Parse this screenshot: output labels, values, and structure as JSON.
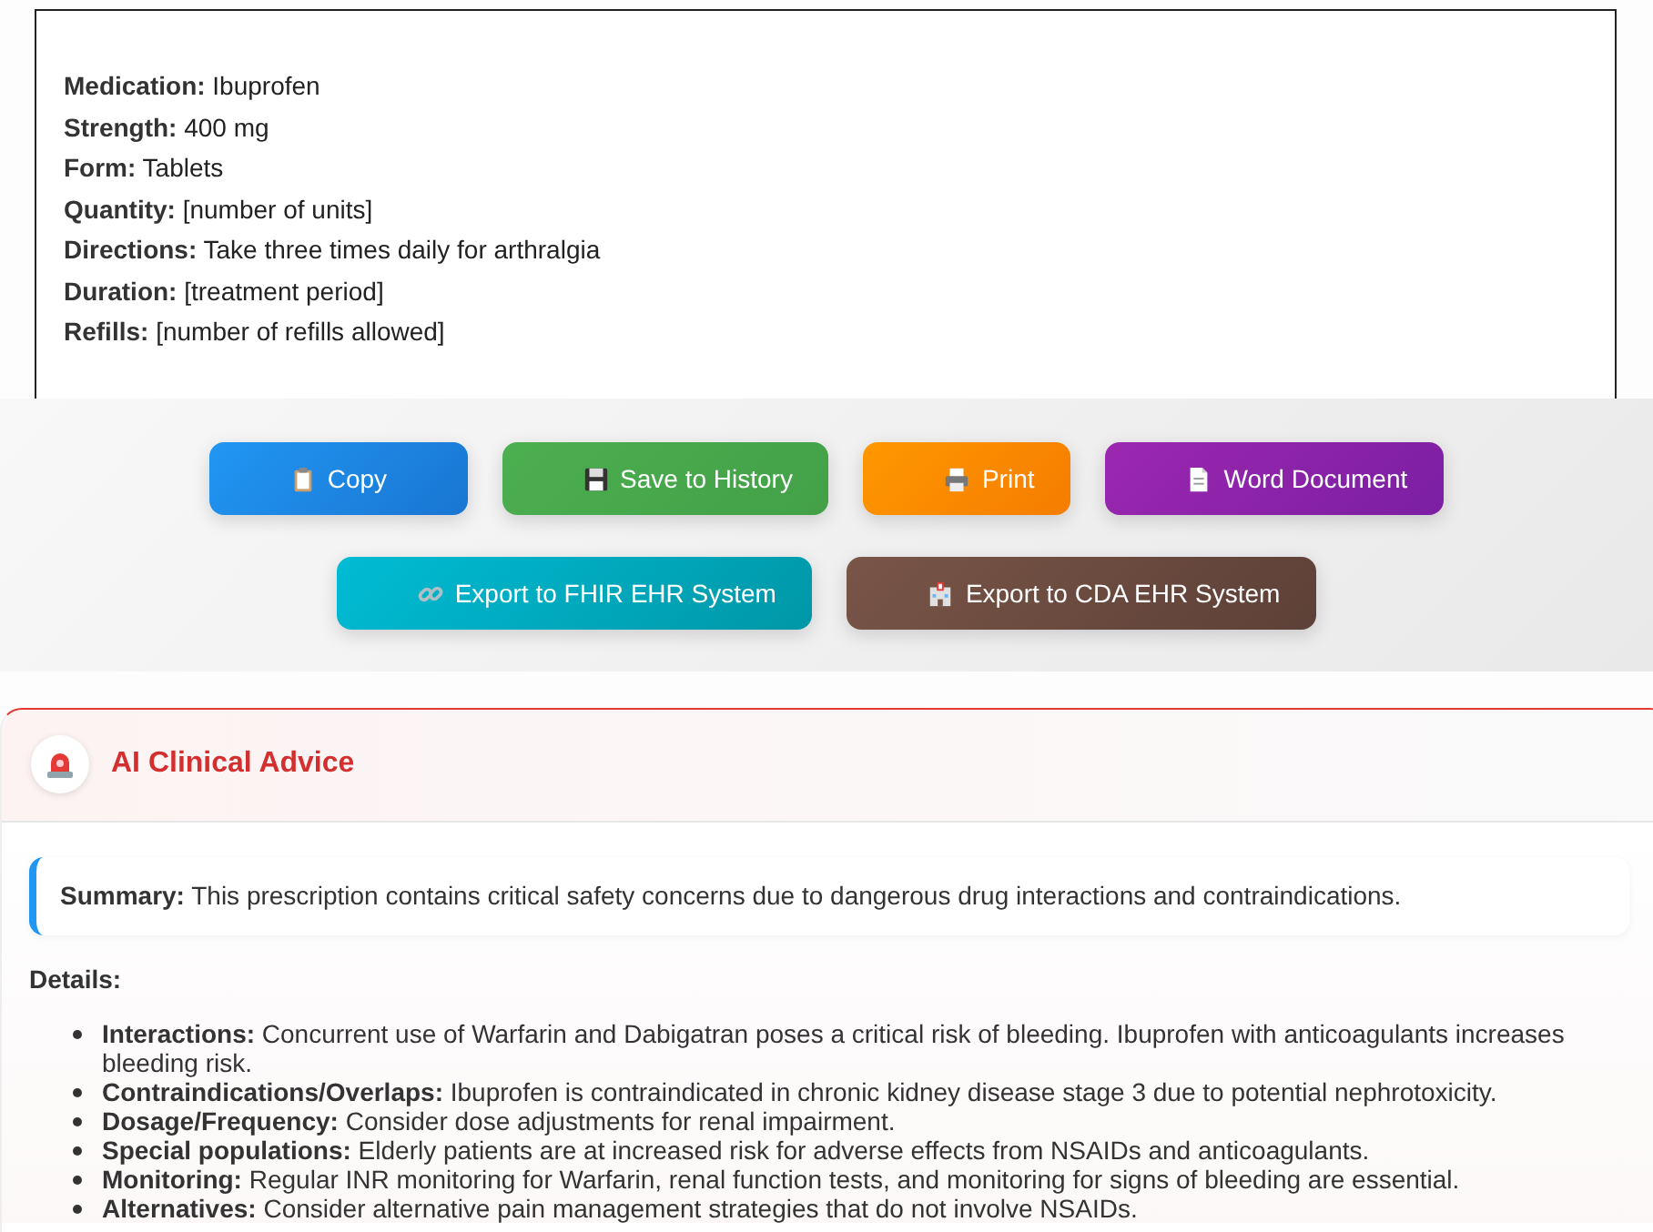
{
  "prescription": [
    {
      "label": "Medication:",
      "value": "Ibuprofen"
    },
    {
      "label": "Strength:",
      "value": "400 mg"
    },
    {
      "label": "Form:",
      "value": "Tablets"
    },
    {
      "label": "Quantity:",
      "value": "[number of units]"
    },
    {
      "label": "Directions:",
      "value": "Take three times daily for arthralgia"
    },
    {
      "label": "Duration:",
      "value": "[treatment period]"
    },
    {
      "label": "Refills:",
      "value": "[number of refills allowed]"
    }
  ],
  "action_rows": [
    [
      {
        "kind": "copy",
        "label": "Copy"
      },
      {
        "kind": "save",
        "label": "Save to History"
      },
      {
        "kind": "print",
        "label": "Print"
      },
      {
        "kind": "word",
        "label": "Word Document"
      }
    ],
    [
      {
        "kind": "fhir",
        "label": "Export to FHIR EHR System"
      },
      {
        "kind": "cda",
        "label": "Export to CDA EHR System"
      }
    ]
  ],
  "advice": {
    "title": "AI Clinical Advice",
    "summary": "**Summary:** This prescription contains critical safety concerns due to dangerous drug interactions and contraindications.",
    "details_heading": "Details:",
    "details": [
      "**Interactions:** Concurrent use of Warfarin and Dabigatran poses a critical risk of bleeding. Ibuprofen with anticoagulants increases bleeding risk.",
      "**Contraindications/Overlaps:** Ibuprofen is contraindicated in chronic kidney disease stage 3 due to potential nephrotoxicity.",
      "**Dosage/Frequency:** Consider dose adjustments for renal impairment.",
      "**Special populations:** Elderly patients are at increased risk for adverse effects from NSAIDs and anticoagulants.",
      "**Monitoring:** Regular INR monitoring for Warfarin, renal function tests, and monitoring for signs of bleeding are essential.",
      "**Alternatives:** Consider alternative pain management strategies that do not involve NSAIDs."
    ]
  }
}
